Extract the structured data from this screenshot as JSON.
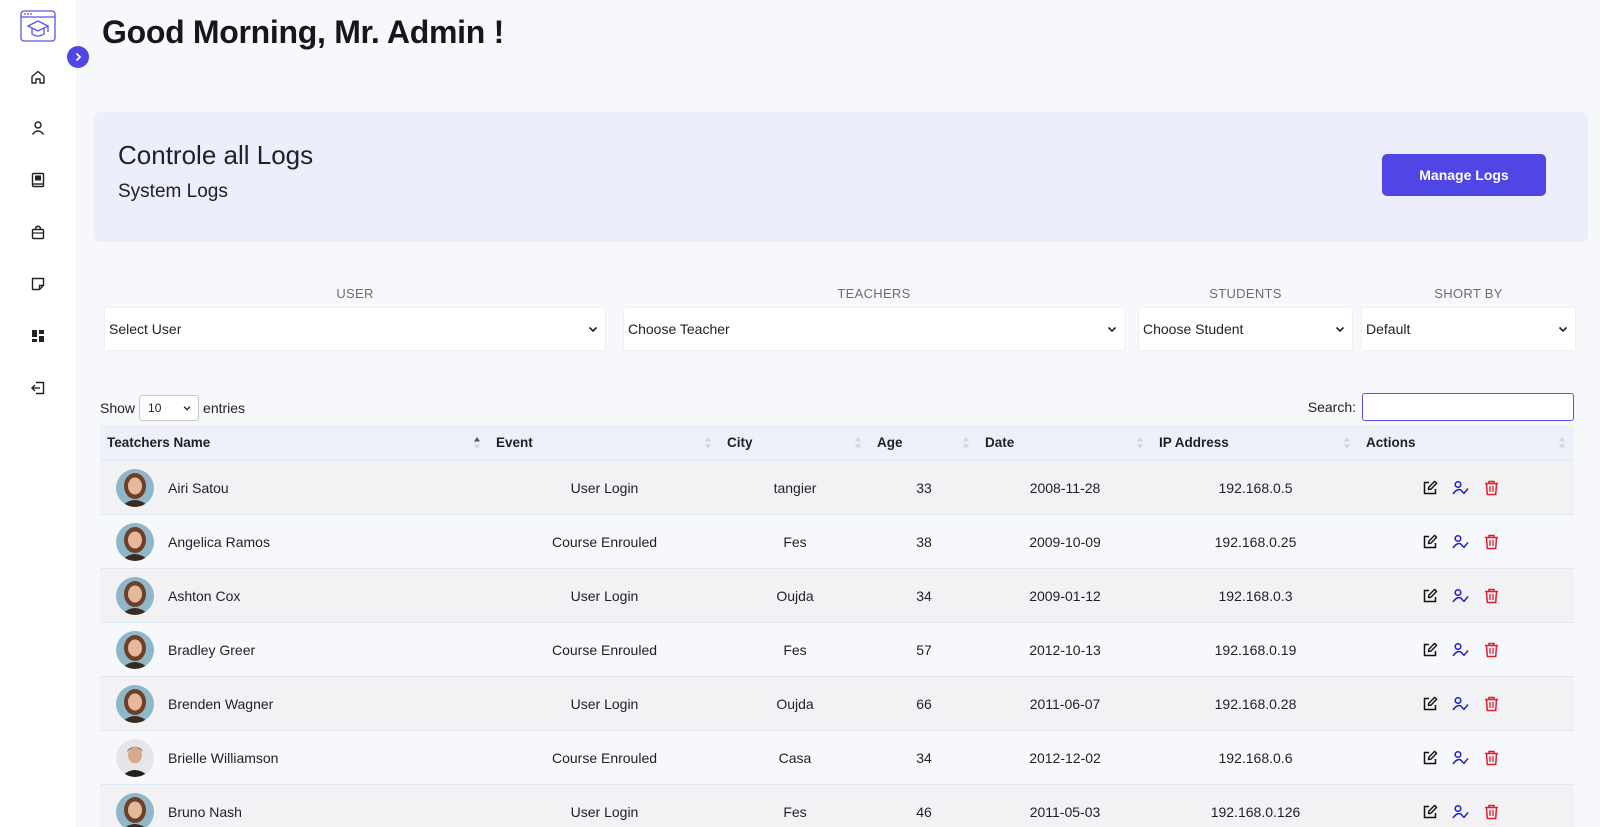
{
  "header": {
    "greeting": "Good Morning, Mr. Admin !"
  },
  "banner": {
    "title": "Controle all Logs",
    "subtitle": "System Logs",
    "button_label": "Manage Logs"
  },
  "sidebar": {
    "icons": [
      "home-icon",
      "user-icon",
      "book-icon",
      "bag-icon",
      "note-icon",
      "dashboard-icon",
      "logout-icon"
    ]
  },
  "filters": [
    {
      "label": "USER",
      "value": "Select User"
    },
    {
      "label": "TEACHERS",
      "value": "Choose Teacher"
    },
    {
      "label": "STUDENTS",
      "value": "Choose Student"
    },
    {
      "label": "SHORT BY",
      "value": "Default"
    }
  ],
  "table_controls": {
    "show_label": "Show",
    "entries_value": "10",
    "entries_label": "entries",
    "search_label": "Search:"
  },
  "table": {
    "columns": [
      "Teatchers Name",
      "Event",
      "City",
      "Age",
      "Date",
      "IP Address",
      "Actions"
    ],
    "rows": [
      {
        "name": "Airi Satou",
        "event": "User Login",
        "city": "tangier",
        "age": "33",
        "date": "2008-11-28",
        "ip": "192.168.0.5",
        "avatar": "female"
      },
      {
        "name": "Angelica Ramos",
        "event": "Course Enrouled",
        "city": "Fes",
        "age": "38",
        "date": "2009-10-09",
        "ip": "192.168.0.25",
        "avatar": "female"
      },
      {
        "name": "Ashton Cox",
        "event": "User Login",
        "city": "Oujda",
        "age": "34",
        "date": "2009-01-12",
        "ip": "192.168.0.3",
        "avatar": "female"
      },
      {
        "name": "Bradley Greer",
        "event": "Course Enrouled",
        "city": "Fes",
        "age": "57",
        "date": "2012-10-13",
        "ip": "192.168.0.19",
        "avatar": "female"
      },
      {
        "name": "Brenden Wagner",
        "event": "User Login",
        "city": "Oujda",
        "age": "66",
        "date": "2011-06-07",
        "ip": "192.168.0.28",
        "avatar": "female"
      },
      {
        "name": "Brielle Williamson",
        "event": "Course Enrouled",
        "city": "Casa",
        "age": "34",
        "date": "2012-12-02",
        "ip": "192.168.0.6",
        "avatar": "male"
      },
      {
        "name": "Bruno Nash",
        "event": "User Login",
        "city": "Fes",
        "age": "46",
        "date": "2011-05-03",
        "ip": "192.168.0.126",
        "avatar": "female"
      }
    ]
  },
  "colors": {
    "accent": "#4f46e5",
    "delete": "#e11d2e",
    "assign": "#1d1dcc"
  }
}
